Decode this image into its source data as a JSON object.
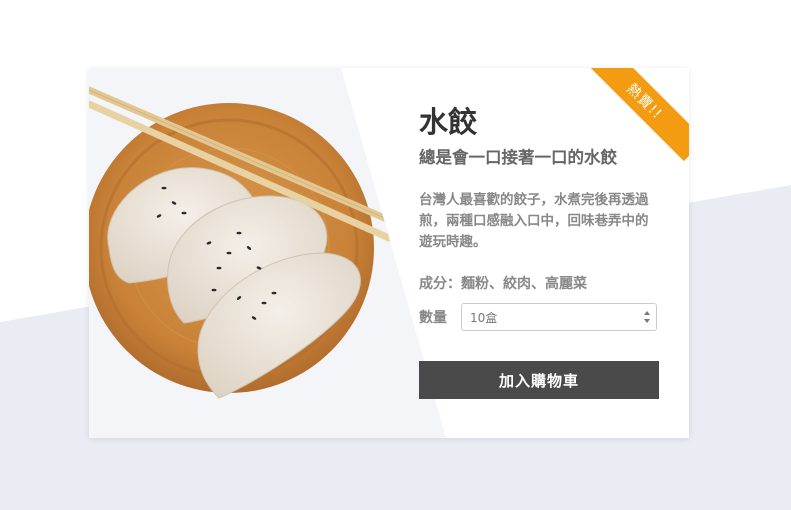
{
  "product": {
    "title": "水餃",
    "subtitle": "總是會一口接著一口的水餃",
    "description": "台灣人最喜歡的餃子，水煮完後再透過煎，兩種口感融入口中，回味巷弄中的遊玩時趣。",
    "ingredients": "成分：麵粉、絞肉、高麗菜",
    "badge": "熱賣!!"
  },
  "quantity": {
    "label": "數量",
    "selected": "10盒"
  },
  "actions": {
    "add_to_cart": "加入購物車"
  },
  "colors": {
    "ribbon": "#f39c12",
    "button": "#4a4a4a",
    "background_band": "#eaecf3",
    "plate": "#c9853f"
  },
  "icons": {
    "select_arrows": "updown-chevron-icon"
  }
}
